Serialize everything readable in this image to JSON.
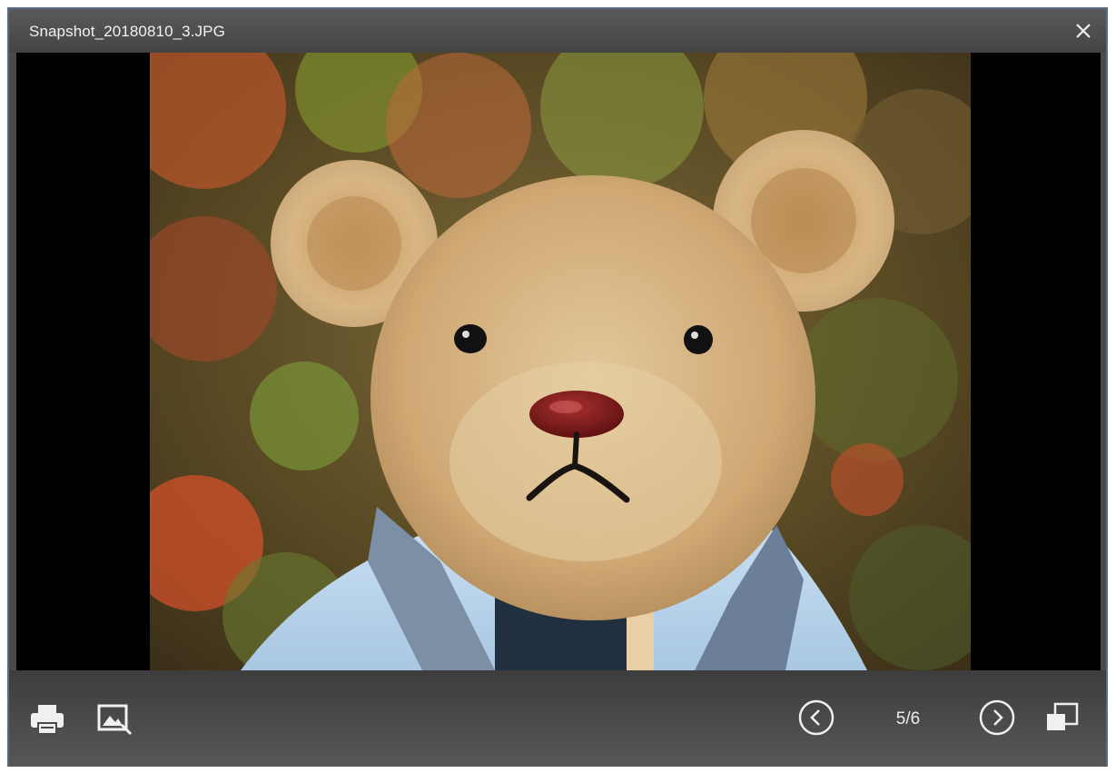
{
  "window": {
    "title": "Snapshot_20180810_3.JPG",
    "close_icon": "close-icon"
  },
  "viewer": {
    "image_description": "teddy-bear-head-photo"
  },
  "toolbar": {
    "print_icon": "print-icon",
    "edit_image_icon": "image-edit-icon",
    "prev_icon": "chevron-left-circle-icon",
    "next_icon": "chevron-right-circle-icon",
    "fullscreen_icon": "restore-window-icon",
    "counter": "5/6"
  },
  "colors": {
    "titlebar": "#4f4f4f",
    "toolbar": "#4a4a4a",
    "border": "#5b6b86",
    "viewer_background": "#000000"
  }
}
